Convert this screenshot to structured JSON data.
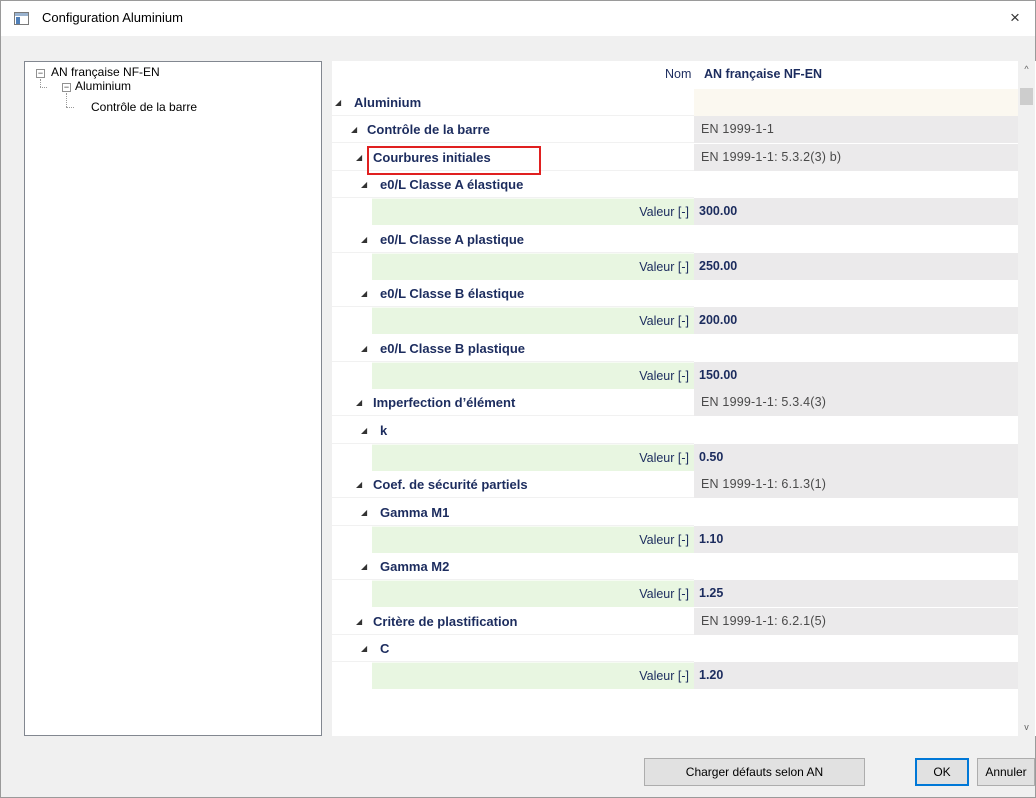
{
  "window": {
    "title": "Configuration Aluminium",
    "close_glyph": "×"
  },
  "tree": {
    "items": [
      {
        "label": "AN française NF-EN",
        "expander": "−"
      },
      {
        "label": "Aluminium",
        "expander": "−"
      },
      {
        "label": "Contrôle de la barre"
      }
    ]
  },
  "properties": {
    "header": {
      "nom_label": "Nom",
      "nom_value": "AN française NF-EN"
    },
    "collapse_glyph": "◢",
    "valeur_label": "Valeur [-]",
    "rows": [
      {
        "kind": "section",
        "level": 0,
        "label": "Aluminium",
        "ref": ""
      },
      {
        "kind": "section",
        "level": 1,
        "label": "Contrôle de la barre",
        "ref": "EN 1999-1-1"
      },
      {
        "kind": "section",
        "level": 2,
        "label": "Courbures initiales",
        "ref": "EN 1999-1-1: 5.3.2(3) b)"
      },
      {
        "kind": "section",
        "level": 3,
        "label": "e0/L Classe A élastique",
        "ref": ""
      },
      {
        "kind": "value",
        "value": "300.00"
      },
      {
        "kind": "section",
        "level": 3,
        "label": "e0/L Classe A plastique",
        "ref": ""
      },
      {
        "kind": "value",
        "value": "250.00"
      },
      {
        "kind": "section",
        "level": 3,
        "label": "e0/L Classe B élastique",
        "ref": ""
      },
      {
        "kind": "value",
        "value": "200.00"
      },
      {
        "kind": "section",
        "level": 3,
        "label": "e0/L Classe B plastique",
        "ref": ""
      },
      {
        "kind": "value",
        "value": "150.00"
      },
      {
        "kind": "section",
        "level": 2,
        "label": "Imperfection d’élément",
        "ref": "EN 1999-1-1: 5.3.4(3)"
      },
      {
        "kind": "section",
        "level": 3,
        "label": "k",
        "ref": ""
      },
      {
        "kind": "value",
        "value": "0.50"
      },
      {
        "kind": "section",
        "level": 2,
        "label": "Coef. de sécurité partiels",
        "ref": "EN 1999-1-1: 6.1.3(1)"
      },
      {
        "kind": "section",
        "level": 3,
        "label": "Gamma M1",
        "ref": ""
      },
      {
        "kind": "value",
        "value": "1.10"
      },
      {
        "kind": "section",
        "level": 3,
        "label": "Gamma M2",
        "ref": ""
      },
      {
        "kind": "value",
        "value": "1.25"
      },
      {
        "kind": "section",
        "level": 2,
        "label": "Critère de plastification",
        "ref": "EN 1999-1-1: 6.2.1(5)"
      },
      {
        "kind": "section",
        "level": 3,
        "label": "C",
        "ref": ""
      },
      {
        "kind": "value",
        "value": "1.20"
      }
    ]
  },
  "scrollbar": {
    "up_glyph": "^",
    "down_glyph": "v"
  },
  "buttons": {
    "load_defaults": "Charger défauts selon AN",
    "ok": "OK",
    "cancel": "Annuler"
  },
  "colors": {
    "highlight": "#e02020",
    "value_bg": "#e8f6e1",
    "label_text": "#1c2c5e"
  }
}
